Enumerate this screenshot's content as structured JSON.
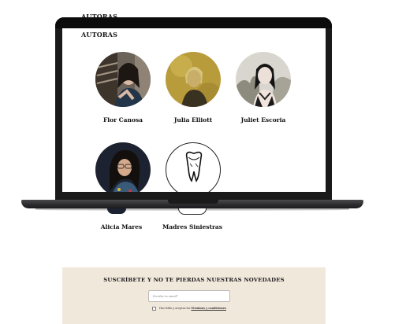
{
  "header": {
    "section_title": "AUTORAS"
  },
  "screen": {
    "section_title": "AUTORAS"
  },
  "authors": [
    {
      "name": "Flor Canosa",
      "icon": "portrait-photo"
    },
    {
      "name": "Julia Elliott",
      "icon": "portrait-photo"
    },
    {
      "name": "Juliet Escoria",
      "icon": "portrait-photo"
    },
    {
      "name": "Alicia Mares",
      "icon": "portrait-photo"
    },
    {
      "name": "Madres Siniestras",
      "icon": "tooth-icon"
    }
  ],
  "newsletter": {
    "title": "SUSCRÍBETE Y NO TE PIERDAS NUESTRAS NOVEDADES",
    "email_placeholder": "Escribe tu email*",
    "terms_prefix": "Has leído y aceptas los ",
    "terms_link": "Términos y condiciones"
  },
  "colors": {
    "newsletter_bg": "#f1e8dc",
    "laptop_frame": "#1a1a1a",
    "photo_gold": "#b89b3a"
  }
}
